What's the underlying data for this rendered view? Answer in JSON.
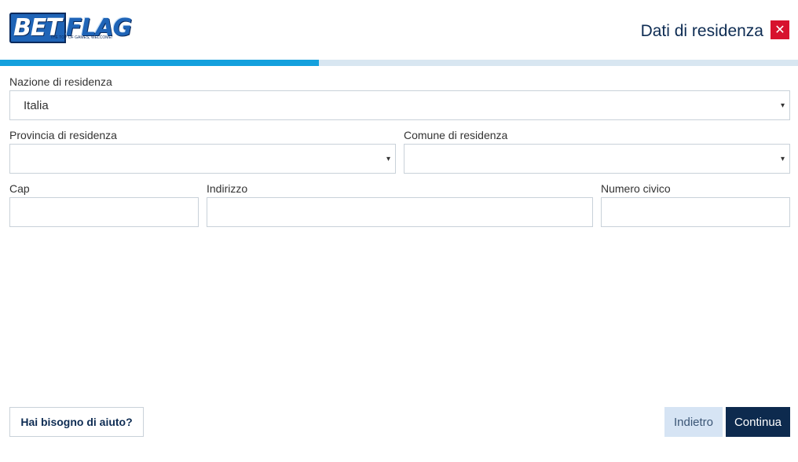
{
  "brand": {
    "logo_text_bet": "BET",
    "logo_text_flag": "FLAG",
    "tagline": "THE TOP OF GAMES, WELCOME!"
  },
  "header": {
    "title": "Dati di residenza",
    "close_icon": "close-icon"
  },
  "progress": {
    "fraction": 0.4,
    "fill_color": "#14a0dd",
    "track_color": "#d8e6f1"
  },
  "form": {
    "nazione": {
      "label": "Nazione di residenza",
      "value": "Italia",
      "caret": "▾"
    },
    "provincia": {
      "label": "Provincia di residenza",
      "value": "",
      "caret": "▾"
    },
    "comune": {
      "label": "Comune di residenza",
      "value": "",
      "caret": "▾"
    },
    "cap": {
      "label": "Cap",
      "value": ""
    },
    "indirizzo": {
      "label": "Indirizzo",
      "value": ""
    },
    "numero_civico": {
      "label": "Numero civico",
      "value": ""
    }
  },
  "footer": {
    "help_label": "Hai bisogno di aiuto?",
    "back_label": "Indietro",
    "next_label": "Continua"
  },
  "colors": {
    "accent": "#d7122e",
    "primary": "#0d2a4e",
    "secondary": "#d6e4f4"
  }
}
